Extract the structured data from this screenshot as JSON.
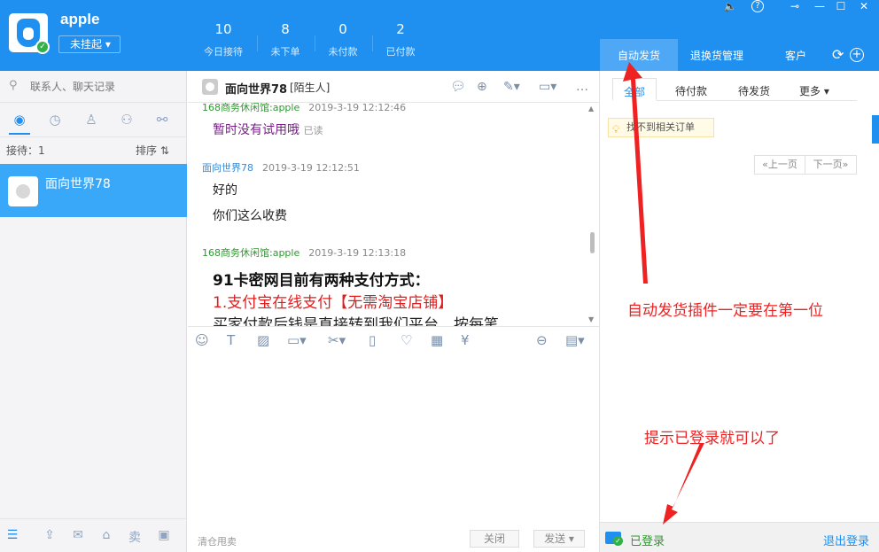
{
  "header": {
    "username": "apple",
    "status": "未挂起 ▾",
    "stats": [
      {
        "value": "10",
        "label": "今日接待"
      },
      {
        "value": "8",
        "label": "未下单"
      },
      {
        "value": "0",
        "label": "未付款"
      },
      {
        "value": "2",
        "label": "已付款"
      }
    ],
    "window_controls": [
      "🔈",
      "?",
      "⊸",
      "—",
      "☐",
      "✕"
    ],
    "right_tabs": {
      "auto_delivery": "自动发货",
      "returns": "退换货管理",
      "customer": "客户"
    }
  },
  "left": {
    "search_placeholder": "联系人、聊天记录",
    "reception_label": "接待：1",
    "sort_label": "排序 ⇅",
    "contact_name": "面向世界78"
  },
  "chat": {
    "contact_name": "面向世界78",
    "contact_tag": "[陌生人]",
    "messages": [
      {
        "sender": "168商务休闲馆:apple",
        "time": "2019-3-19 12:12:46",
        "text": "暂时没有试用哦",
        "read": "已读"
      },
      {
        "sender": "面向世界78",
        "time": "2019-3-19 12:12:51",
        "lines": [
          "好的",
          "你们这么收费"
        ]
      },
      {
        "sender": "168商务休闲馆:apple",
        "time": "2019-3-19 12:13:18",
        "bold_line": "91卡密网目前有两种支付方式：",
        "red_line": "1.支付宝在线支付【无需淘宝店铺】",
        "partial_line": "买家付款后钱是直接转到我们平台，按每笔"
      }
    ],
    "quick_reply": "清仓甩卖",
    "close_label": "关闭",
    "send_label": "发送 ▾"
  },
  "right": {
    "subtabs": [
      "全部",
      "待付款",
      "待发货",
      "更多 ▾"
    ],
    "notice": "找不到相关订单",
    "prev_page": "«上一页",
    "next_page": "下一页»",
    "login_status": "已登录",
    "logout": "退出登录"
  },
  "annotations": {
    "top": "自动发货插件一定要在第一位",
    "bottom": "提示已登录就可以了"
  },
  "colors": {
    "brand": "#1f8ff0",
    "annotation": "#ee2222",
    "green": "#34b04a"
  }
}
